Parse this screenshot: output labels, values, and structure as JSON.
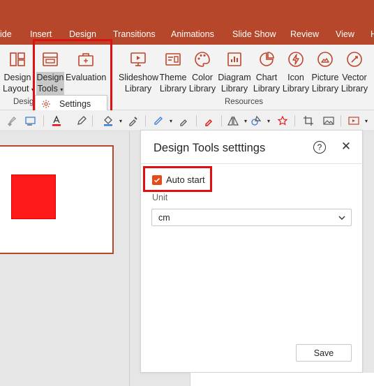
{
  "tabs": [
    "ide",
    "Insert",
    "Design",
    "Transitions",
    "Animations",
    "Slide Show",
    "Review",
    "View",
    "H"
  ],
  "ribbon": {
    "buttons": [
      {
        "line1": "Design",
        "line2": "Layout",
        "caret": "▾",
        "icon": "layout-icon"
      },
      {
        "line1": "Design",
        "line2": "Tools",
        "caret": "▾",
        "icon": "design-tools-icon"
      },
      {
        "line1": "Evaluation",
        "line2": "",
        "icon": "briefcase-icon"
      },
      {
        "line1": "Slideshow",
        "line2": "Library",
        "icon": "slideshow-icon"
      },
      {
        "line1": "Theme",
        "line2": "Library",
        "icon": "theme-icon"
      },
      {
        "line1": "Color",
        "line2": "Library",
        "icon": "palette-icon"
      },
      {
        "line1": "Diagram",
        "line2": "Library",
        "icon": "diagram-icon"
      },
      {
        "line1": "Chart",
        "line2": "Library",
        "icon": "chart-icon"
      },
      {
        "line1": "Icon",
        "line2": "Library",
        "icon": "icon-library-icon"
      },
      {
        "line1": "Picture",
        "line2": "Library",
        "icon": "picture-icon"
      },
      {
        "line1": "Vector",
        "line2": "Library",
        "icon": "vector-icon"
      }
    ],
    "group_design": "Desig",
    "group_resources": "Resources"
  },
  "dropdown": {
    "settings_label": "Settings"
  },
  "pane": {
    "title": "Design Tools setttings",
    "help": "?",
    "close": "✕",
    "autostart_label": "Auto start",
    "unit_label": "Unit",
    "unit_value": "cm",
    "save_label": "Save"
  },
  "colors": {
    "accent": "#b7472a",
    "icon": "#c0452c",
    "highlight": "#e01010",
    "checkbox": "#e64a19",
    "shape": "#ff1a1a"
  }
}
